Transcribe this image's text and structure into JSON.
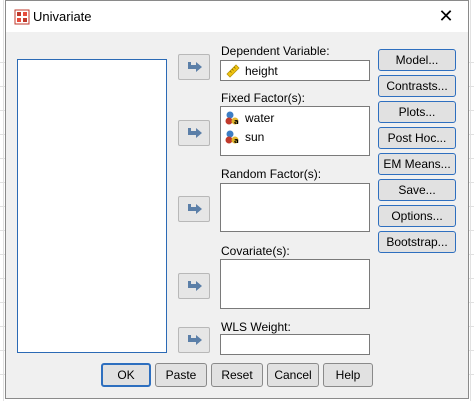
{
  "window": {
    "title": "Univariate",
    "close_symbol": "✕"
  },
  "dependent": {
    "label": "Dependent Variable:",
    "items": [
      {
        "name": "height",
        "icon": "scale-ruler-icon"
      }
    ]
  },
  "fixed": {
    "label": "Fixed Factor(s):",
    "items": [
      {
        "name": "water",
        "icon": "nominal-variable-icon"
      },
      {
        "name": "sun",
        "icon": "nominal-variable-icon"
      }
    ]
  },
  "random": {
    "label": "Random Factor(s):"
  },
  "covariate": {
    "label": "Covariate(s):"
  },
  "wls": {
    "label": "WLS Weight:"
  },
  "side_buttons": [
    {
      "label": "Model..."
    },
    {
      "label": "Contrasts..."
    },
    {
      "label": "Plots..."
    },
    {
      "label": "Post Hoc..."
    },
    {
      "label": "EM Means..."
    },
    {
      "label": "Save..."
    },
    {
      "label": "Options..."
    },
    {
      "label": "Bootstrap..."
    }
  ],
  "bottom_buttons": [
    {
      "label": "OK"
    },
    {
      "label": "Paste"
    },
    {
      "label": "Reset"
    },
    {
      "label": "Cancel"
    },
    {
      "label": "Help"
    }
  ],
  "colors": {
    "accent": "#2e6fbf",
    "window_bg": "#f0f0f0"
  }
}
